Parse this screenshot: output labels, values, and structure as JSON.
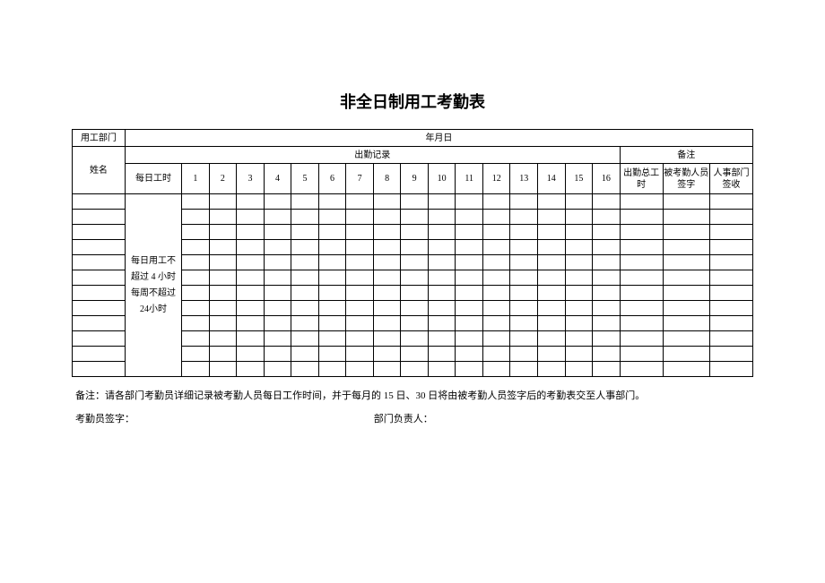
{
  "title": "非全日制用工考勤表",
  "header": {
    "dept_label": "用工部门",
    "date_label": "年月日",
    "name_label": "姓名",
    "attendance_label": "出勤记录",
    "remarks_label": "备注",
    "daily_hours_label": "每日工时",
    "days": [
      "1",
      "2",
      "3",
      "4",
      "5",
      "6",
      "7",
      "8",
      "9",
      "10",
      "11",
      "12",
      "13",
      "14",
      "15",
      "16"
    ],
    "total_hours_label": "出勤总工时",
    "signee_label": "被考勤人员签字",
    "hr_label": "人事部门签收"
  },
  "daily_note": "每日用工不超过 4 小时每周不超过 24小时",
  "footer": {
    "note": "备注：请各部门考勤员详细记录被考勤人员每日工作时间，并于每月的 15 日、30 日将由被考勤人员签字后的考勤表交至人事部门。",
    "recorder_label": "考勤员签字：",
    "manager_label": "部门负责人："
  },
  "rows": 12
}
